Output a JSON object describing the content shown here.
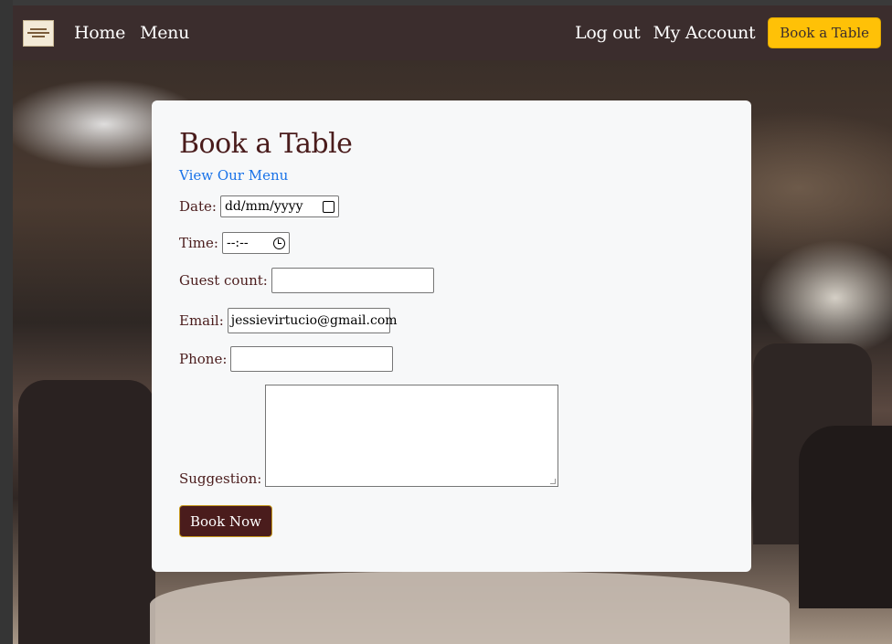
{
  "nav": {
    "logo_icon": "restaurant-logo",
    "links": [
      "Home",
      "Menu"
    ],
    "right_links": [
      "Log out",
      "My Account"
    ],
    "cta": "Book a Table"
  },
  "form": {
    "title": "Book a Table",
    "menu_link": "View Our Menu",
    "date_label": "Date:",
    "date_value": "dd/mm/yyyy",
    "time_label": "Time:",
    "time_value": "--:--",
    "guest_label": "Guest count:",
    "guest_value": "",
    "email_label": "Email:",
    "email_value": "jessievirtucio@gmail.com",
    "phone_label": "Phone:",
    "phone_value": "",
    "suggestion_label": "Suggestion:",
    "suggestion_value": "",
    "submit": "Book Now"
  },
  "colors": {
    "navbar": "#3b2d2d",
    "accent": "#ffc107",
    "brand": "#4a1c1c",
    "link": "#1a73e8"
  }
}
